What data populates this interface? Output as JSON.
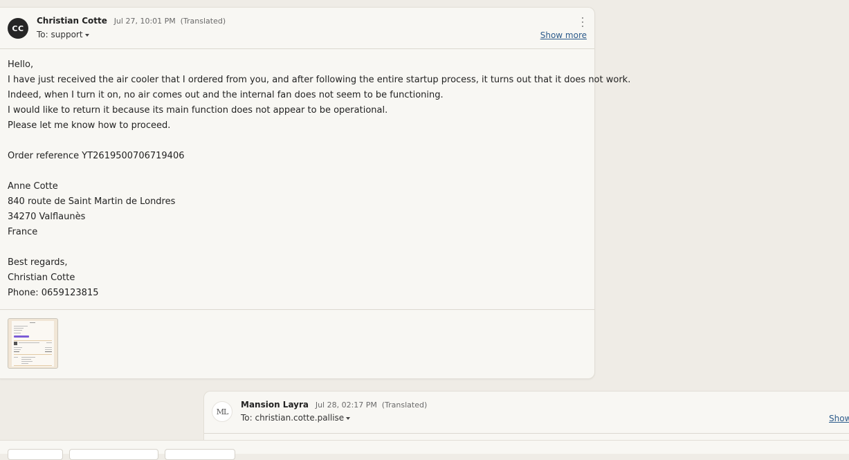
{
  "message": {
    "avatar_initials": "CC",
    "sender": "Christian Cotte",
    "datetime": "Jul 27, 10:01 PM",
    "translated": "(Translated)",
    "to": "To: support",
    "show_more": "Show more",
    "body_lines": [
      "Hello,",
      "I have just received the air cooler that I ordered from you, and after following the entire startup process, it turns out that it does not work.",
      "Indeed, when I turn it on, no air comes out and the internal fan does not seem to be functioning.",
      "I would like to return it because its main function does not appear to be operational.",
      "Please let me know how to proceed.",
      "",
      "Order reference YT2619500706719406",
      "",
      "Anne Cotte",
      "840 route de Saint Martin de Londres",
      "34270 Valflaunès",
      "France",
      "",
      "Best regards,",
      "Christian Cotte",
      "Phone: 0659123815"
    ],
    "attachment_icon": "document-thumbnail"
  },
  "reply": {
    "avatar_initials": "ML",
    "sender": "Mansion Layra",
    "datetime": "Jul 28, 02:17 PM",
    "translated": "(Translated)",
    "to": "To: christian.cotte.pallise",
    "show_more": "Show"
  },
  "colors": {
    "page_bg": "#efece6",
    "card_bg": "#f8f7f3",
    "link": "#2b5a8a",
    "avatar_dark": "#262626",
    "thumb_accent": "#7b5cd6"
  }
}
